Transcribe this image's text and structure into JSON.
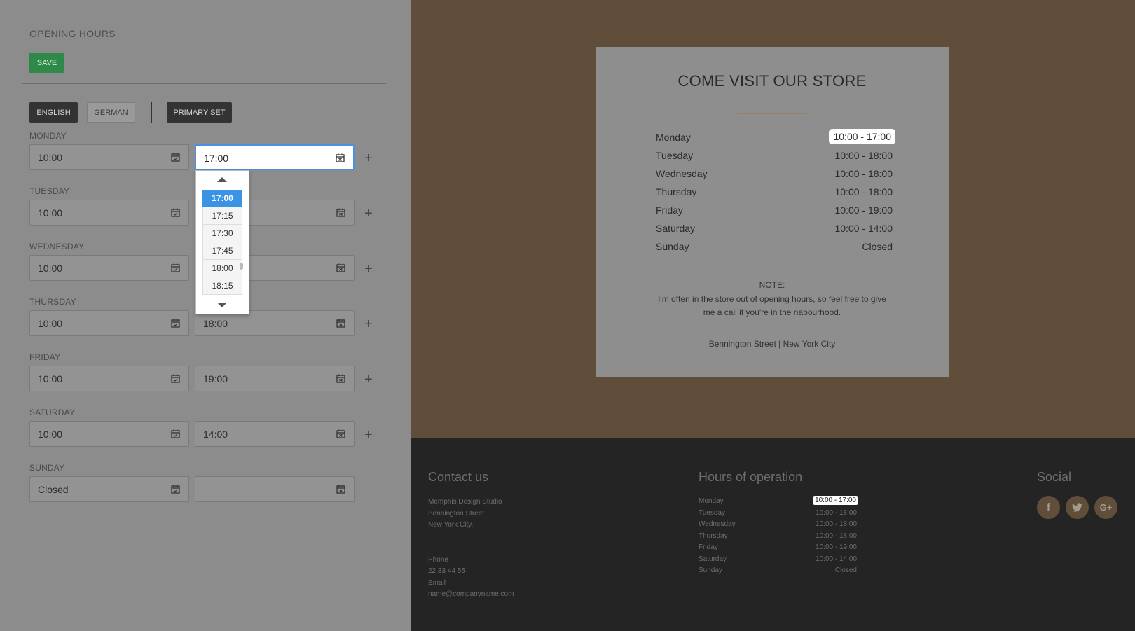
{
  "editor": {
    "title": "OPENING HOURS",
    "save_label": "SAVE",
    "lang_english": "ENGLISH",
    "lang_german": "GERMAN",
    "primary_set": "PRIMARY SET",
    "days": [
      {
        "label": "MONDAY",
        "open": "10:00",
        "close": "17:00"
      },
      {
        "label": "TUESDAY",
        "open": "10:00",
        "close": ""
      },
      {
        "label": "WEDNESDAY",
        "open": "10:00",
        "close": ""
      },
      {
        "label": "THURSDAY",
        "open": "10:00",
        "close": "18:00"
      },
      {
        "label": "FRIDAY",
        "open": "10:00",
        "close": "19:00"
      },
      {
        "label": "SATURDAY",
        "open": "10:00",
        "close": "14:00"
      },
      {
        "label": "SUNDAY",
        "open": "Closed",
        "close": ""
      }
    ],
    "plus_symbol": "+",
    "dropdown_options": [
      "17:00",
      "17:15",
      "17:30",
      "17:45",
      "18:00",
      "18:15"
    ],
    "dropdown_selected": "17:00"
  },
  "store": {
    "title": "COME VISIT OUR STORE",
    "hours": [
      {
        "day": "Monday",
        "time": "10:00 - 17:00"
      },
      {
        "day": "Tuesday",
        "time": "10:00 - 18:00"
      },
      {
        "day": "Wednesday",
        "time": "10:00 - 18:00"
      },
      {
        "day": "Thursday",
        "time": "10:00 - 18:00"
      },
      {
        "day": "Friday",
        "time": "10:00 - 19:00"
      },
      {
        "day": "Saturday",
        "time": "10:00 - 14:00"
      },
      {
        "day": "Sunday",
        "time": "Closed"
      }
    ],
    "note_label": "NOTE:",
    "note_line1": "I'm often in the store out of opening hours, so feel free to give",
    "note_line2": "me a call if you're in the nabourhood.",
    "address": "Bennington Street | New York City"
  },
  "footer": {
    "contact_heading": "Contact us",
    "company": "Memphis Design Studio",
    "street": "Bennington Street",
    "city": "New York City,",
    "phone_label": "Phone",
    "phone": "22 33 44 55",
    "email_label": "Email",
    "email": "name@companyname.com",
    "hours_heading": "Hours of operation",
    "hours": [
      {
        "day": "Monday",
        "time": "10:00 - 17:00"
      },
      {
        "day": "Tuesday",
        "time": "10:00 - 18:00"
      },
      {
        "day": "Wednesday",
        "time": "10:00 - 18:00"
      },
      {
        "day": "Thursday",
        "time": "10:00 - 18:00"
      },
      {
        "day": "Friday",
        "time": "10:00 - 19:00"
      },
      {
        "day": "Saturday",
        "time": "10:00 - 14:00"
      },
      {
        "day": "Sunday",
        "time": "Closed"
      }
    ],
    "social_heading": "Social",
    "social": [
      {
        "icon": "facebook-icon",
        "glyph": "f"
      },
      {
        "icon": "twitter-icon",
        "glyph": "t"
      },
      {
        "icon": "google-plus-icon",
        "glyph": "G+"
      }
    ]
  },
  "colors": {
    "save_green": "#2f8a4a",
    "active_blue": "#4a90e2",
    "brand_brown": "#614e3a",
    "footer_dark": "#242424"
  }
}
